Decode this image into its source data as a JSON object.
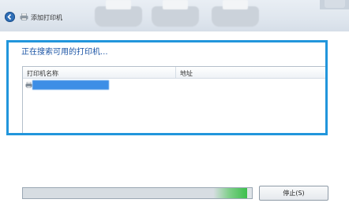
{
  "window": {
    "title": "添加打印机",
    "back_icon": "back-arrow-icon",
    "title_icon": "printer-icon",
    "colors": {
      "accent": "#1b54a5",
      "highlight_border": "#2196dc",
      "progress_green": "#3cbf4c"
    }
  },
  "main": {
    "heading": "正在搜索可用的打印机...",
    "list": {
      "columns": [
        "打印机名称",
        "地址"
      ],
      "rows": [
        {
          "name": "",
          "address": "",
          "icon": "printer-icon",
          "selected": true
        }
      ]
    }
  },
  "footer": {
    "progress_fraction": 0.98,
    "stop_label": "停止(S)"
  }
}
